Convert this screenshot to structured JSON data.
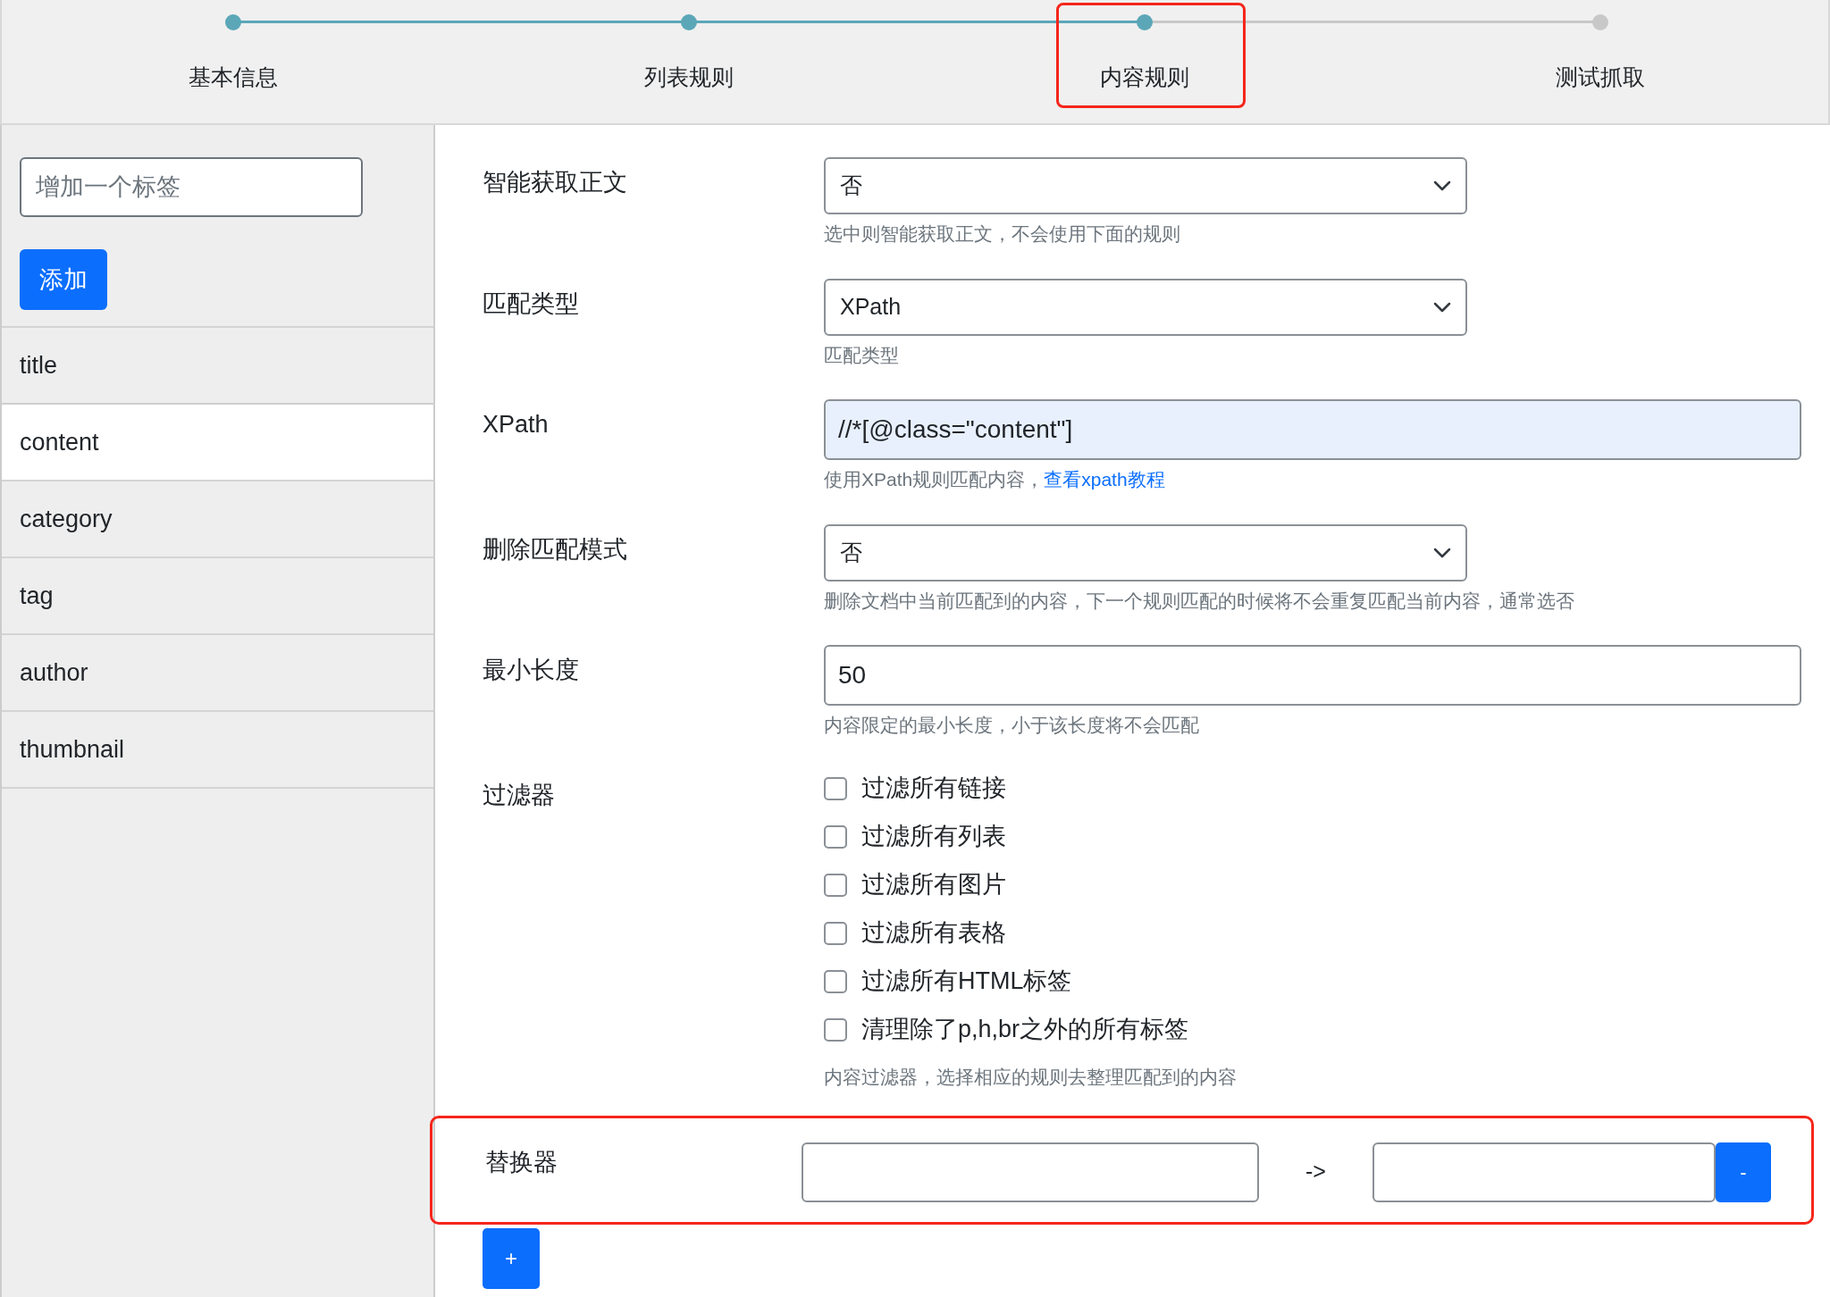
{
  "steps": [
    {
      "label": "基本信息",
      "reached": true,
      "highlighted": false
    },
    {
      "label": "列表规则",
      "reached": true,
      "highlighted": false
    },
    {
      "label": "内容规则",
      "reached": true,
      "highlighted": true
    },
    {
      "label": "测试抓取",
      "reached": false,
      "highlighted": false
    }
  ],
  "sidebar": {
    "tag_input": {
      "placeholder": "增加一个标签"
    },
    "add_button": "添加",
    "items": [
      {
        "label": "title",
        "selected": false
      },
      {
        "label": "content",
        "selected": true
      },
      {
        "label": "category",
        "selected": false
      },
      {
        "label": "tag",
        "selected": false
      },
      {
        "label": "author",
        "selected": false
      },
      {
        "label": "thumbnail",
        "selected": false
      }
    ]
  },
  "form": [
    {
      "kind": "select",
      "label": "智能获取正文",
      "value": "否",
      "hint": "选中则智能获取正文，不会使用下面的规则"
    },
    {
      "kind": "select",
      "label": "匹配类型",
      "value": "XPath",
      "hint": "匹配类型"
    },
    {
      "kind": "text",
      "label": "XPath",
      "value": "//*[@class=\"content\"]",
      "autofilled": true,
      "hint": "使用XPath规则匹配内容，",
      "link": "查看xpath教程"
    },
    {
      "kind": "select",
      "label": "删除匹配模式",
      "value": "否",
      "hint": "删除文档中当前匹配到的内容，下一个规则匹配的时候将不会重复匹配当前内容，通常选否"
    },
    {
      "kind": "text",
      "label": "最小长度",
      "value": "50",
      "autofilled": false,
      "hint": "内容限定的最小长度，小于该长度将不会匹配"
    },
    {
      "kind": "checkboxes",
      "label": "过滤器",
      "options": [
        {
          "label": "过滤所有链接",
          "checked": false
        },
        {
          "label": "过滤所有列表",
          "checked": false
        },
        {
          "label": "过滤所有图片",
          "checked": false
        },
        {
          "label": "过滤所有表格",
          "checked": false
        },
        {
          "label": "过滤所有HTML标签",
          "checked": false
        },
        {
          "label": "清理除了p,h,br之外的所有标签",
          "checked": false
        }
      ],
      "hint": "内容过滤器，选择相应的规则去整理匹配到的内容"
    }
  ],
  "replacer": {
    "label": "替换器",
    "arrow": "->",
    "remove_button": "-",
    "add_button": "+",
    "highlighted": true
  }
}
